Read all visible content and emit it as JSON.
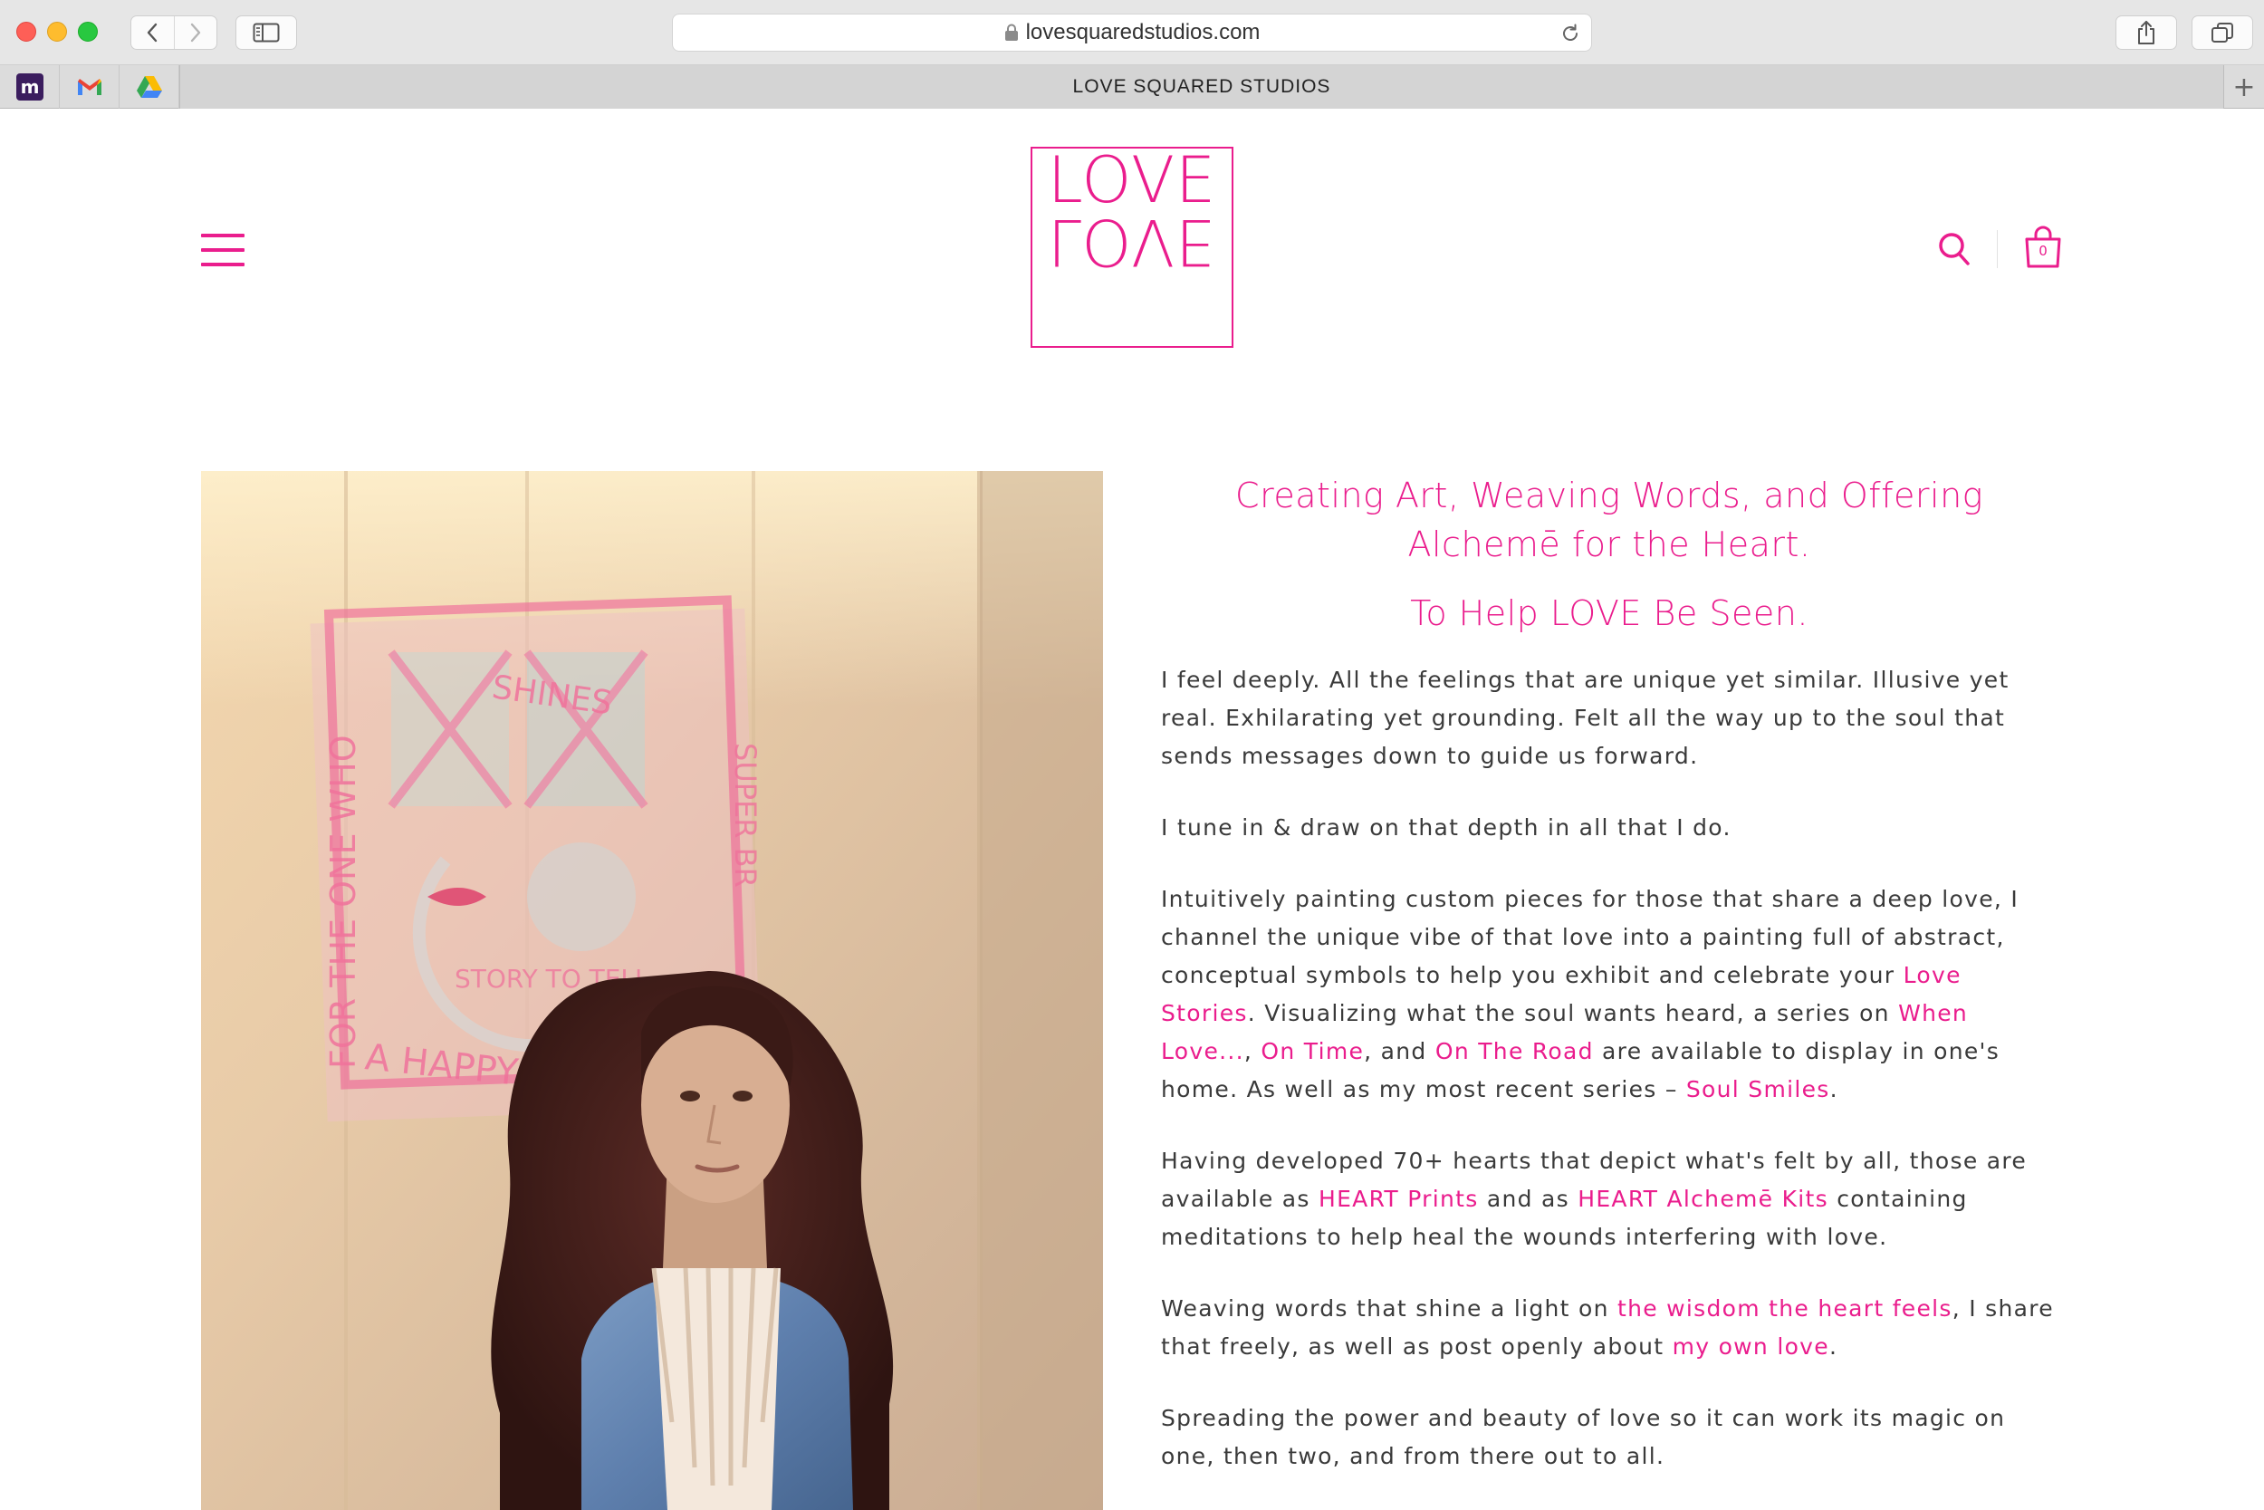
{
  "browser": {
    "url": "lovesquaredstudios.com",
    "tab_title": "LOVE SQUARED STUDIOS",
    "favorites": [
      "m-icon",
      "gmail-icon",
      "google-drive-icon"
    ],
    "new_tab_label": "+"
  },
  "site": {
    "logo_text": "LOVE",
    "cart_count": "0",
    "accent_color": "#ea1d8d"
  },
  "hero": {
    "headline": "Creating Art, Weaving Words, and Offering Alchemē for the Heart.",
    "subheadline": "To Help LOVE Be Seen."
  },
  "paragraphs": {
    "p1": "I feel deeply. All the feelings that are unique yet similar. Illusive yet real. Exhilarating yet grounding. Felt all the way up to the soul that sends messages down to guide us forward.",
    "p2": "I tune in & draw on that depth in all that I do.",
    "p3": {
      "t1": "Intuitively painting custom pieces for those that share a deep love, I channel the unique vibe of that love into a painting full of abstract, conceptual symbols to help you exhibit and celebrate your ",
      "link_love_stories": "Love Stories",
      "t2": ". Visualizing what the soul wants heard, a series on ",
      "link_when_love": "When Love...",
      "t3": ", ",
      "link_on_time": "On Time",
      "t4": ", and ",
      "link_on_the_road": "On The Road",
      "t5": " are available to display in one's home. As well as my most recent series – ",
      "link_soul_smiles": "Soul Smiles",
      "t6": "."
    },
    "p4": {
      "t1": "Having developed 70+ hearts that depict what's felt by all, those are available as ",
      "link_heart_prints": "HEART Prints",
      "t2": " and as ",
      "link_heart_kits": "HEART Alchemē Kits",
      "t3": " containing meditations to help heal the wounds interfering with love."
    },
    "p5": {
      "t1": "Weaving words that shine a light on ",
      "link_wisdom": "the wisdom the heart feels",
      "t2": ", I share that freely, as well as post openly about ",
      "link_my_own_love": "my own love",
      "t3": "."
    },
    "p6": "Spreading the power and beauty of love so it can work its magic on one, then two, and from there out to all."
  },
  "photo": {
    "artwork_words": [
      "SHINES",
      "FOR THE ONE WHO",
      "SUPER BR",
      "STORY TO TELL",
      "A HAPPY ENDING"
    ]
  }
}
